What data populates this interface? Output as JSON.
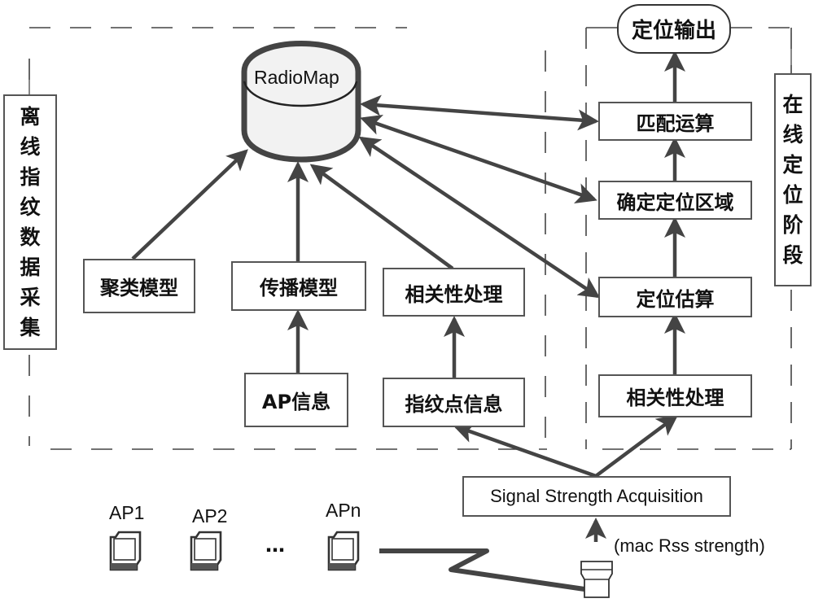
{
  "diagram": {
    "regions": {
      "offline": {
        "label": "离线指纹数据采集"
      },
      "online": {
        "label": "在线定位阶段"
      }
    },
    "database": {
      "label": "RadioMap"
    },
    "offline_nodes": {
      "cluster_model": "聚类模型",
      "propagation_model": "传播模型",
      "correlation_offline": "相关性处理",
      "ap_info": "AP信息",
      "fingerprint_info": "指纹点信息"
    },
    "online_nodes": {
      "output": "定位输出",
      "matching": "匹配运算",
      "determine_region": "确定定位区域",
      "estimate": "定位估算",
      "correlation_online": "相关性处理"
    },
    "acquisition": {
      "label": "Signal Strength Acquisition",
      "input_label": "(mac Rss strength)"
    },
    "access_points": [
      {
        "label": "AP1",
        "icon": "computer-icon"
      },
      {
        "label": "AP2",
        "icon": "computer-icon"
      },
      {
        "label": "APn",
        "icon": "computer-icon"
      }
    ],
    "ellipsis": "…",
    "receiver_icon": "receiver-device-icon",
    "colors": {
      "stroke": "#444444",
      "box_border": "#555555",
      "cylinder_fill": "#f2f2f2"
    }
  }
}
